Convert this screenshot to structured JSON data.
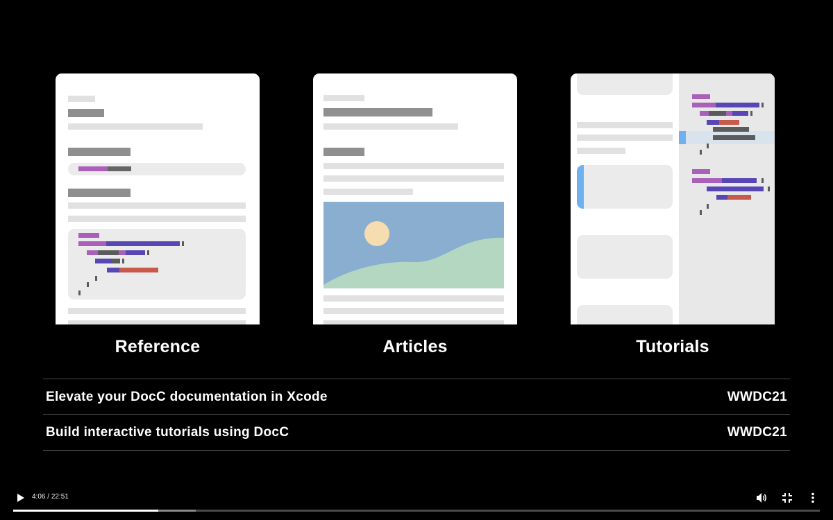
{
  "sections": [
    {
      "caption": "Reference"
    },
    {
      "caption": "Articles"
    },
    {
      "caption": "Tutorials"
    }
  ],
  "related_videos": [
    {
      "title": "Elevate your DocC documentation in Xcode",
      "session": "WWDC21"
    },
    {
      "title": "Build interactive tutorials using DocC",
      "session": "WWDC21"
    }
  ],
  "player": {
    "current_time": "4:06",
    "separator": "/",
    "duration": "22:51",
    "progress_fraction": 0.18,
    "buffered_fraction": 0.226,
    "icons": {
      "play": "play-icon",
      "volume": "volume-icon",
      "exit_fullscreen": "exit-fullscreen-icon",
      "more": "more-options-icon"
    }
  },
  "colors": {
    "background": "#000000",
    "card": "#ffffff",
    "sky": "#8aaed0",
    "hill": "#b3d7c1",
    "sun": "#f5ddaf",
    "accent_blue": "#6fb0ee"
  }
}
